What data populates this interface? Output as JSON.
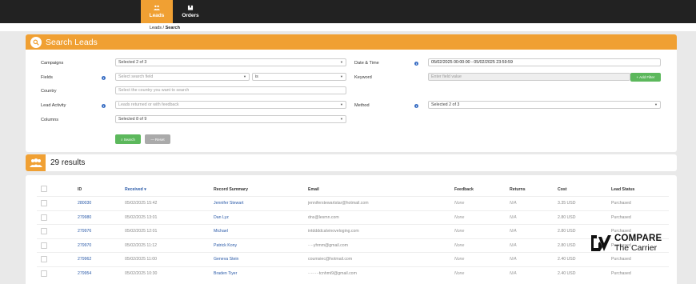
{
  "nav": {
    "tabs": [
      {
        "label": "Leads",
        "icon": "users-icon",
        "active": true
      },
      {
        "label": "Orders",
        "icon": "box-icon",
        "active": false
      }
    ]
  },
  "breadcrumb": {
    "parent": "Leads",
    "sep": " / ",
    "current": "Search"
  },
  "search_panel": {
    "title": "Search Leads",
    "campaigns": {
      "label": "Campaigns",
      "value": "Selected 2 of 3"
    },
    "fields": {
      "label": "Fields",
      "placeholder": "Select search field",
      "operator": "is"
    },
    "country": {
      "label": "Country",
      "placeholder": "Select the country you want to search"
    },
    "lead_activity": {
      "label": "Lead Activity",
      "placeholder": "Leads returned or with feedback"
    },
    "columns": {
      "label": "Columns",
      "value": "Selected 8 of 9"
    },
    "date_time": {
      "label": "Date & Time",
      "value": "05/02/2025 00:00:00 - 05/02/2025 23:59:59"
    },
    "keyword": {
      "label": "Keyword",
      "placeholder": "Enter field value"
    },
    "add_filter": "+ Add Filter",
    "method": {
      "label": "Method",
      "value": "Selected 2 of 3"
    },
    "search_button": "Search",
    "reset_button": "Reset"
  },
  "results": {
    "count_label": "29 results"
  },
  "table": {
    "columns": [
      "ID",
      "Received ▾",
      "Record Summary",
      "Email",
      "Feedback",
      "Returns",
      "Cost",
      "Lead Status"
    ],
    "rows": [
      {
        "id": "280030",
        "received": "05/02/2025 15:42",
        "summary": "Jennifer Stewart",
        "email": "jenniferstewartstar@hotmail.com",
        "feedback": "None",
        "returns": "N/A",
        "cost": "3.35 USD",
        "status": "Purchased"
      },
      {
        "id": "279980",
        "received": "05/02/2025 13:01",
        "summary": "Dan Lyz",
        "email": "dns@lesmn.com",
        "feedback": "None",
        "returns": "N/A",
        "cost": "2.80 USD",
        "status": "Purchased"
      },
      {
        "id": "279976",
        "received": "05/02/2025 12:01",
        "summary": "Michael",
        "email": "intddddcalvinoveloging.com",
        "feedback": "None",
        "returns": "N/A",
        "cost": "2.80 USD",
        "status": "Purchased"
      },
      {
        "id": "279970",
        "received": "05/02/2025 11:12",
        "summary": "Patrick Kony",
        "email": "····yhmm@gmail.com",
        "feedback": "None",
        "returns": "N/A",
        "cost": "2.80 USD",
        "status": "Purchased"
      },
      {
        "id": "279962",
        "received": "05/02/2025 11:00",
        "summary": "Geneva Stein",
        "email": "coumsiec@hotmail.com",
        "feedback": "None",
        "returns": "N/A",
        "cost": "2.40 USD",
        "status": "Purchased"
      },
      {
        "id": "279954",
        "received": "05/02/2025 10:30",
        "summary": "Braden Tiyer",
        "email": "········tcnhmi9@gmail.com",
        "feedback": "None",
        "returns": "N/A",
        "cost": "2.40 USD",
        "status": "Purchased"
      }
    ]
  },
  "watermark": {
    "line1": "COMPARE",
    "line2": "The Carrier"
  },
  "colors": {
    "accent": "#f0a033",
    "nav_bg": "#222222",
    "link": "#2a5aa8",
    "green": "#5cb85c"
  }
}
